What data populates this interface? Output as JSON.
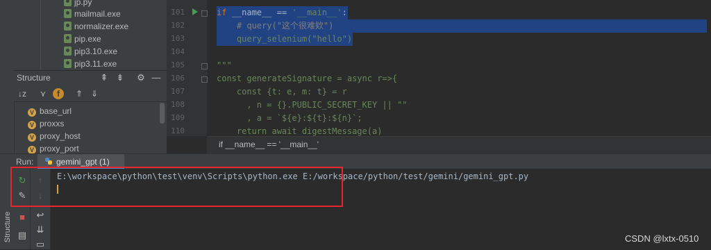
{
  "project_tree": {
    "files": [
      "jp.py",
      "mailmail.exe",
      "normalizer.exe",
      "pip.exe",
      "pip3.10.exe",
      "pip3.11.exe"
    ]
  },
  "structure": {
    "title": "Structure",
    "items": [
      "base_url",
      "proxxs",
      "proxy_host",
      "proxy_port"
    ],
    "badge": "V",
    "vertical_tab": "Structure"
  },
  "editor": {
    "line_numbers": [
      "101",
      "102",
      "103",
      "104",
      "105",
      "106",
      "107",
      "108",
      "109",
      "110"
    ],
    "lines": {
      "l101_kw": "if ",
      "l101_plain1": "__name__ == ",
      "l101_str": "'__main__'",
      "l101_plain2": ":",
      "l102": "    # query(\"这个很难欸\")",
      "l103_fn": "    query_selenium(",
      "l103_str": "\"hello\"",
      "l103_end": ")",
      "l105": "\"\"\"",
      "l106": "const generateSignature = async r=>{",
      "l107": "    const {t: e, m: t} = r",
      "l108": "      , n = {}.PUBLIC_SECRET_KEY || \"\"",
      "l109": "      , a = `${e}:${t}:${n}`;",
      "l110": "    return await digestMessage(a)"
    },
    "breadcrumb": "if __name__ == '__main__'"
  },
  "run": {
    "label": "Run:",
    "tab_label": "gemini_gpt (1)",
    "console_line": "E:\\workspace\\python\\test\\venv\\Scripts\\python.exe E:/workspace/python/test/gemini/gemini_gpt.py"
  },
  "watermark": "CSDN @lxtx-0510",
  "colors": {
    "selection": "#214283",
    "keyword": "#cc7832",
    "string": "#6a8759",
    "highlight_box": "#e8242d",
    "run_arrow": "#499c54"
  }
}
